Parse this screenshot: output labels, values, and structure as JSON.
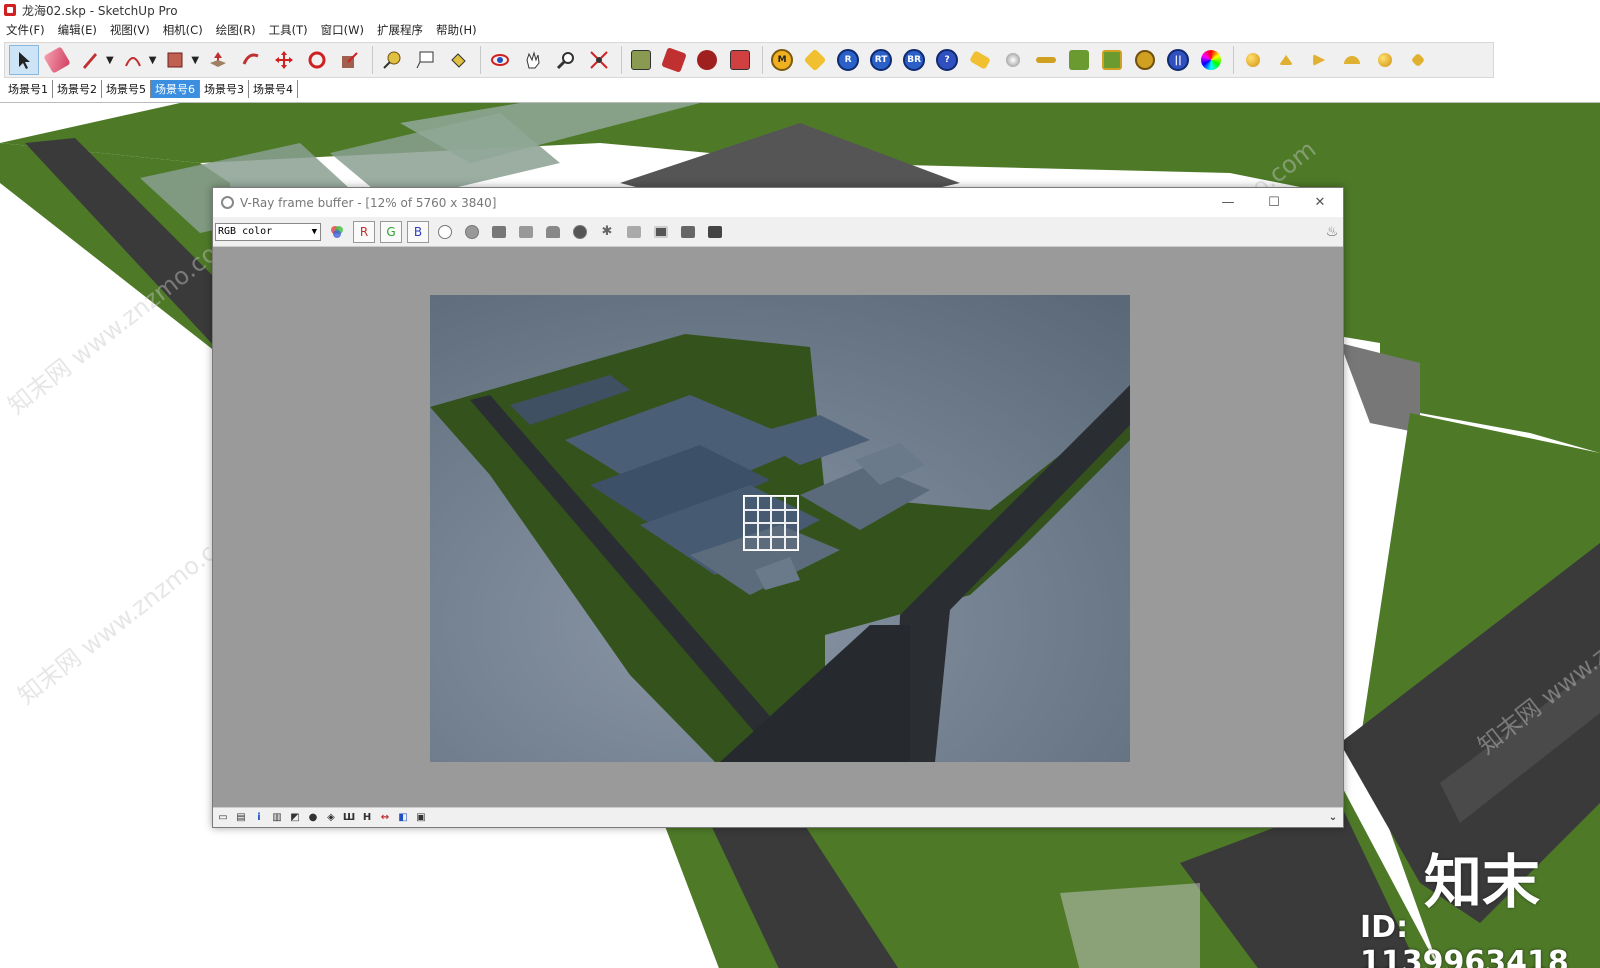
{
  "window": {
    "title": "龙海02.skp - SketchUp Pro"
  },
  "menu": [
    "文件(F)",
    "编辑(E)",
    "视图(V)",
    "相机(C)",
    "绘图(R)",
    "工具(T)",
    "窗口(W)",
    "扩展程序",
    "帮助(H)"
  ],
  "toolbar": {
    "tools": [
      {
        "name": "select-icon"
      },
      {
        "name": "eraser-icon"
      },
      {
        "name": "pencil-icon"
      },
      {
        "name": "arc-icon"
      },
      {
        "name": "rectangle-icon"
      },
      {
        "name": "push-pull-icon"
      },
      {
        "name": "follow-me-icon"
      },
      {
        "name": "move-icon"
      },
      {
        "name": "rotate-icon"
      },
      {
        "name": "scale-icon"
      },
      {
        "name": "tape-measure-icon"
      },
      {
        "name": "text-icon"
      },
      {
        "name": "paint-bucket-icon"
      },
      {
        "name": "orbit-icon"
      },
      {
        "name": "pan-icon"
      },
      {
        "name": "zoom-icon"
      },
      {
        "name": "zoom-extents-icon"
      },
      {
        "name": "warehouse-icon"
      },
      {
        "name": "extension-warehouse-icon"
      },
      {
        "name": "extension-manager-icon"
      },
      {
        "name": "share-model-icon"
      }
    ],
    "vray_buttons": [
      "M",
      "R",
      "RT",
      "BR",
      "?"
    ]
  },
  "scenes": [
    "场景号1",
    "场景号2",
    "场景号5",
    "场景号6",
    "场景号3",
    "场景号4"
  ],
  "active_scene": "场景号6",
  "vfb": {
    "title": "V-Ray frame buffer - [12% of 5760 x 3840]",
    "channel": "RGB color",
    "channel_buttons": [
      "R",
      "G",
      "B"
    ],
    "status_icons": [
      "i",
      "H"
    ]
  },
  "watermark": {
    "brand": "知末",
    "id": "ID: 1139963418",
    "text": "知末网 www.znzmo.com"
  },
  "colors": {
    "grass": "#4e7a28",
    "road": "#3a3a3a",
    "active_tab": "#3c8fe0",
    "render_bg": "#6f7f8f"
  }
}
